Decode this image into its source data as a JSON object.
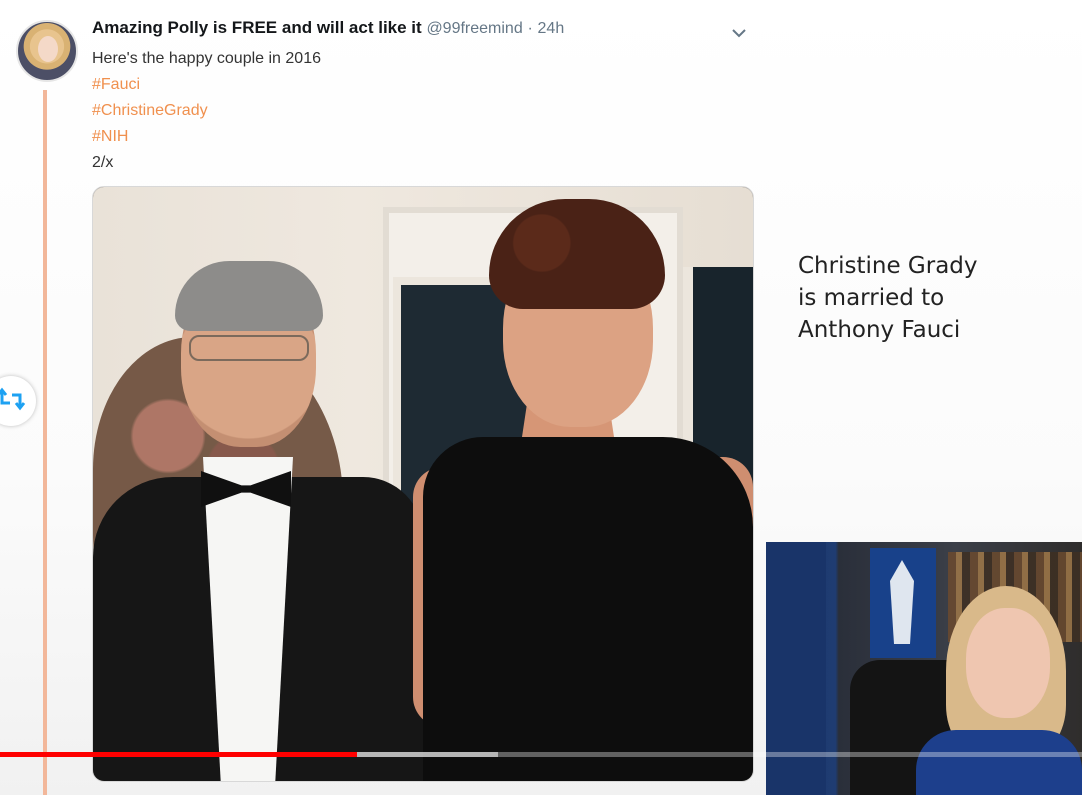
{
  "tweet": {
    "author_name": "Amazing Polly is FREE and will act like it",
    "handle": "@99freemind",
    "separator": "·",
    "time": "24h",
    "text_line": "Here's the happy couple in 2016",
    "hashtags": [
      "#Fauci",
      "#ChristineGrady",
      "#NIH"
    ],
    "thread_count": "2/x"
  },
  "slide_caption": {
    "lines": [
      "Christine Grady",
      "is married to",
      "Anthony Fauci"
    ]
  },
  "icons": {
    "caret": "chevron-down-icon",
    "retweet": "retweet-icon"
  },
  "colors": {
    "hashtag": "#f0904e",
    "thread_line": "#f2b79a",
    "progress_played": "#ff0000",
    "retweet_icon": "#1da1f2"
  },
  "video": {
    "played_fraction": 0.33,
    "buffered_fraction": 0.46
  }
}
